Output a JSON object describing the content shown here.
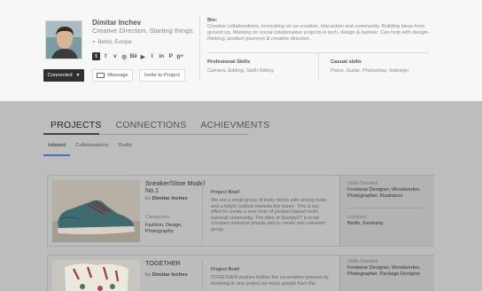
{
  "profile": {
    "name": "Dimitar Inchev",
    "tagline": "Creative Direction, Starting things.",
    "location": "Berlin, Europe",
    "social_icons": [
      "tumblr-icon",
      "facebook-icon",
      "vimeo-icon",
      "dribbble-icon",
      "behance-icon",
      "youtube-icon",
      "tumblr-small-icon",
      "linkedin-icon",
      "pinterest-icon",
      "googleplus-icon"
    ],
    "social_glyphs": [
      "t",
      "f",
      "v",
      "◎",
      "Bē",
      "▶",
      "t",
      "in",
      "P",
      "g+"
    ],
    "connected_label": "Connected",
    "message_label": "Message",
    "invite_label": "Invite to Project",
    "bio_label": "Bio:",
    "bio_text": "Creative collaborations, innovating on co-creation, interaction and community. Building ideas from ground up. Working on social collaborative projects in tech, design & fashion. Can help with design-thinking, product-journeys & creative direction.",
    "professional_skills_label": "Profesional Skills",
    "professional_skills": "Camera, Editing, Sloth-Sitting",
    "casual_skills_label": "Casual skills",
    "casual_skills": "Piano, Guitar, Photoshop, Indesign"
  },
  "tabs": [
    {
      "label": "PROJECTS",
      "active": true
    },
    {
      "label": "CONNECTIONS",
      "active": false
    },
    {
      "label": "ACHIEVMENTS",
      "active": false
    }
  ],
  "subtabs": [
    {
      "label": "Initiated",
      "active": true
    },
    {
      "label": "Collaborations",
      "active": false
    },
    {
      "label": "Drafts",
      "active": false
    }
  ],
  "projects": [
    {
      "title": "Sneaker/Shoe Model No.1",
      "by_prefix": "by",
      "author": "Dimitar Inchev",
      "categories_label": "Categories:",
      "categories": "Fashion, Design, Photography",
      "brief_label": "Project Brief:",
      "brief": "We are a small group of lively minds with strong roots and a bright outlook towards the future. This is our effort to create a new form of product-based multi-national community. The idea of Society27 is to be constant metamor-phosis and to create one coherent group",
      "skills_label": "Skills Needed",
      "skills": "Footwear Designer, Woodworker, Photographer, Illustrators",
      "location_label": "Location:",
      "location": "Berlin, Germany"
    },
    {
      "title": "TOGETHER",
      "by_prefix": "by",
      "author": "Dimitar Inchev",
      "brief_label": "Project Brief:",
      "brief": "TOGETHER pushes further the co-creation process by involving in one project as many people from the",
      "skills_label": "Skills Needed",
      "skills": "Footwear Designer, Woodworker, Photographer, Package Designer"
    }
  ],
  "colors": {
    "accent_blue": "#4a72b5",
    "dark_button": "#2f2f2f",
    "overlay_gray": "#bdbdbd"
  }
}
